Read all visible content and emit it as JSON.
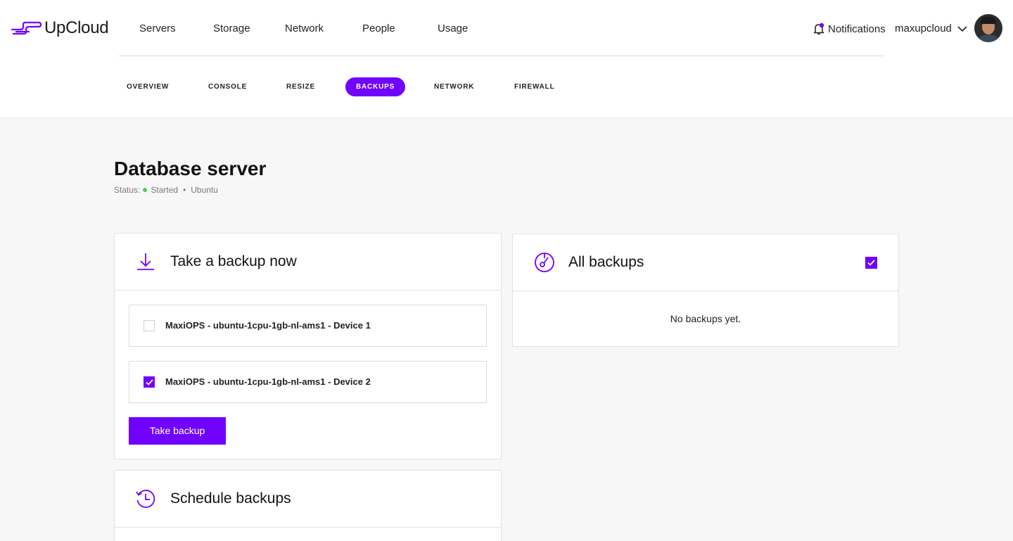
{
  "brand": {
    "name": "UpCloud",
    "accent": "#7000ff"
  },
  "nav": {
    "items": [
      {
        "label": "Servers"
      },
      {
        "label": "Storage"
      },
      {
        "label": "Network"
      },
      {
        "label": "People"
      },
      {
        "label": "Usage"
      }
    ]
  },
  "header": {
    "notifications_label": "Notifications",
    "username": "maxupcloud"
  },
  "subtabs": [
    {
      "label": "OVERVIEW"
    },
    {
      "label": "CONSOLE"
    },
    {
      "label": "RESIZE"
    },
    {
      "label": "BACKUPS",
      "active": true
    },
    {
      "label": "NETWORK"
    },
    {
      "label": "FIREWALL"
    }
  ],
  "page": {
    "title": "Database server",
    "status_label": "Status:",
    "status_value": "Started",
    "status_color": "#4ccc4c",
    "os": "Ubuntu"
  },
  "take_backup": {
    "title": "Take a backup now",
    "devices": [
      {
        "label": "MaxiOPS - ubuntu-1cpu-1gb-nl-ams1 - Device 1",
        "checked": false
      },
      {
        "label": "MaxiOPS - ubuntu-1cpu-1gb-nl-ams1 - Device 2",
        "checked": true
      }
    ],
    "button_label": "Take backup"
  },
  "all_backups": {
    "title": "All backups",
    "empty_text": "No backups yet.",
    "select_all_checked": true
  },
  "schedule": {
    "title": "Schedule backups"
  }
}
